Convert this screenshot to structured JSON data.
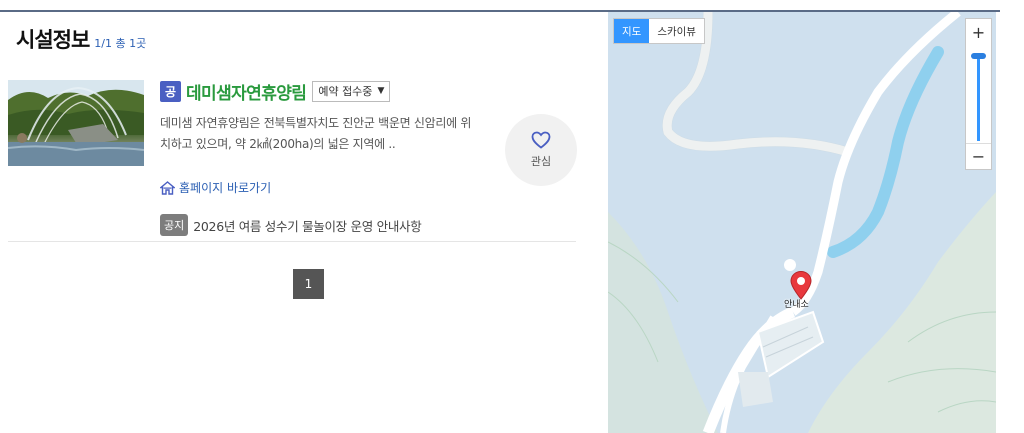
{
  "header": {
    "title": "시설정보",
    "count": "1/1 총 1곳"
  },
  "facility": {
    "type_badge": "공",
    "name": "데미샘자연휴양림",
    "status": "예약 접수중",
    "status_arrow": "▼",
    "description": "데미샘 자연휴양림은 전북특별자치도 진안군 백운면 신암리에 위치하고 있으며, 약 2㎢(200ha)의 넓은 지역에 ..",
    "homepage_link": "홈페이지 바로가기",
    "notice_badge": "공지",
    "notice_text": "2026년 여름 성수기 물놀이장 운영 안내사항",
    "like_label": "관심"
  },
  "pagination": {
    "current": "1"
  },
  "map": {
    "type_map": "지도",
    "type_skyview": "스카이뷰",
    "zoom_in": "+",
    "zoom_out": "−",
    "marker_label": "안내소",
    "colors": {
      "water": "#cfe0ee",
      "stream": "#8fd0ee",
      "land": "#dce8e0",
      "road": "#ffffff",
      "marker": "#e8383d",
      "active_tab": "#3396ff"
    }
  },
  "colors": {
    "facility_name": "#2a9a3e",
    "badge": "#4a5fc2",
    "link": "#2b5fb3"
  }
}
